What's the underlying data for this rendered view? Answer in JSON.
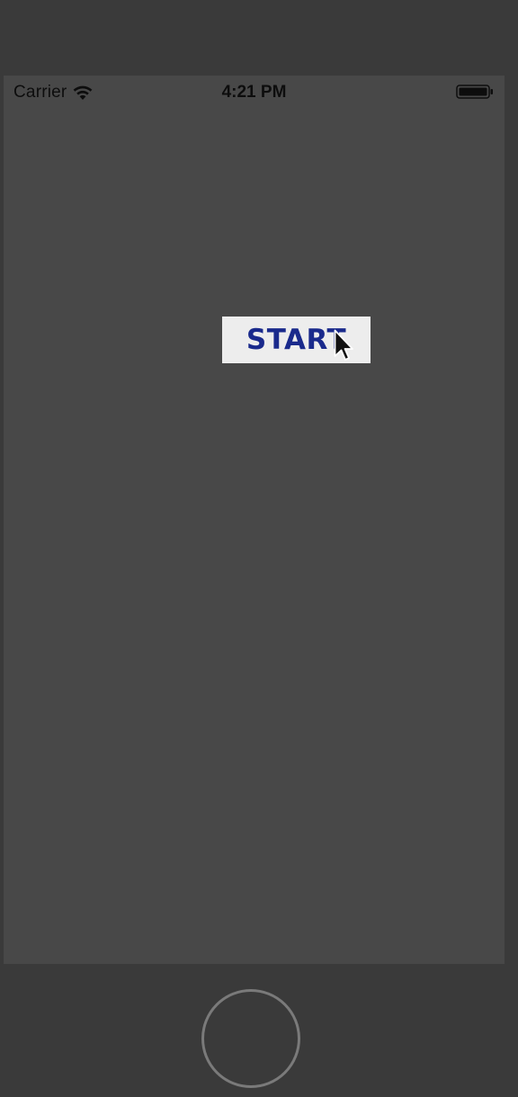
{
  "status_bar": {
    "carrier": "Carrier",
    "time": "4:21 PM",
    "wifi_icon": "wifi-icon",
    "battery_icon": "battery-icon"
  },
  "main": {
    "start_label": "START"
  },
  "colors": {
    "screen_bg": "#484848",
    "device_bg": "#3a3a3a",
    "button_bg": "#ededed",
    "button_text": "#1a2a8c"
  }
}
